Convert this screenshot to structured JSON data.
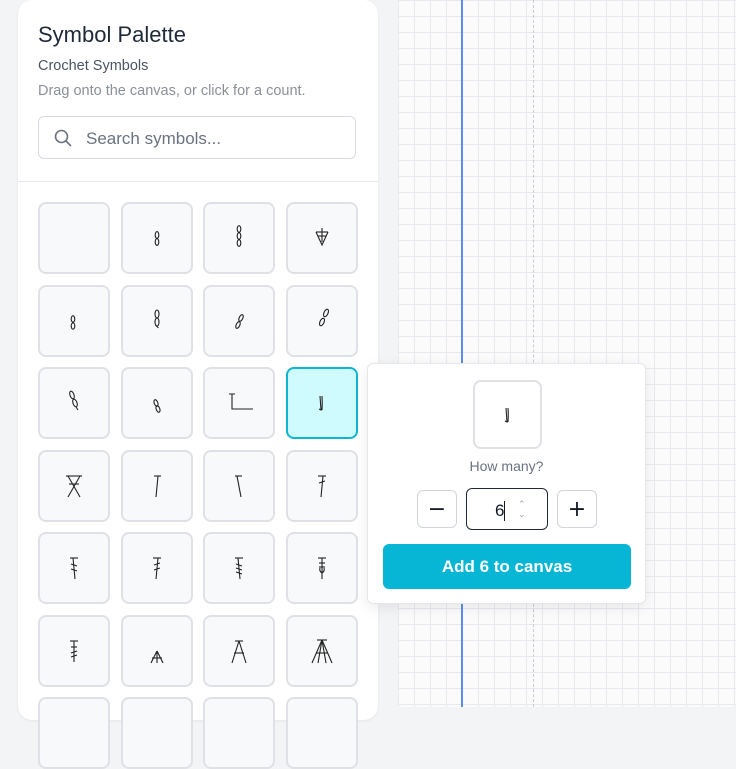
{
  "palette": {
    "title": "Symbol Palette",
    "subtitle": "Crochet Symbols",
    "hint": "Drag onto the canvas, or click for a count.",
    "search_placeholder": "Search symbols...",
    "search_value": ""
  },
  "symbols": [
    {
      "name": "empty-symbol-icon",
      "selected": false
    },
    {
      "name": "chain-stitch-icon",
      "selected": false
    },
    {
      "name": "double-chain-icon",
      "selected": false
    },
    {
      "name": "slip-stitch-v-icon",
      "selected": false
    },
    {
      "name": "chain-small-icon",
      "selected": false
    },
    {
      "name": "chain-tall-icon",
      "selected": false
    },
    {
      "name": "chain-slant-icon",
      "selected": false
    },
    {
      "name": "chain-slant-tall-icon",
      "selected": false
    },
    {
      "name": "chain-twisted-icon",
      "selected": false
    },
    {
      "name": "chain-tilt-icon",
      "selected": false
    },
    {
      "name": "turning-chain-icon",
      "selected": false
    },
    {
      "name": "single-line-icon",
      "selected": true
    },
    {
      "name": "cross-stitch-icon",
      "selected": false
    },
    {
      "name": "half-double-icon",
      "selected": false
    },
    {
      "name": "half-double-slant-icon",
      "selected": false
    },
    {
      "name": "double-crochet-icon",
      "selected": false
    },
    {
      "name": "treble-icon",
      "selected": false
    },
    {
      "name": "treble-slant-icon",
      "selected": false
    },
    {
      "name": "double-treble-icon",
      "selected": false
    },
    {
      "name": "triple-treble-icon",
      "selected": false
    },
    {
      "name": "double-treble-alt-icon",
      "selected": false
    },
    {
      "name": "decrease-2-icon",
      "selected": false
    },
    {
      "name": "decrease-3-icon",
      "selected": false
    },
    {
      "name": "decrease-4-icon",
      "selected": false
    }
  ],
  "popover": {
    "how_many": "How many?",
    "minus_label": "−",
    "plus_label": "+",
    "quantity": "6",
    "add_button": "Add 6 to canvas"
  }
}
